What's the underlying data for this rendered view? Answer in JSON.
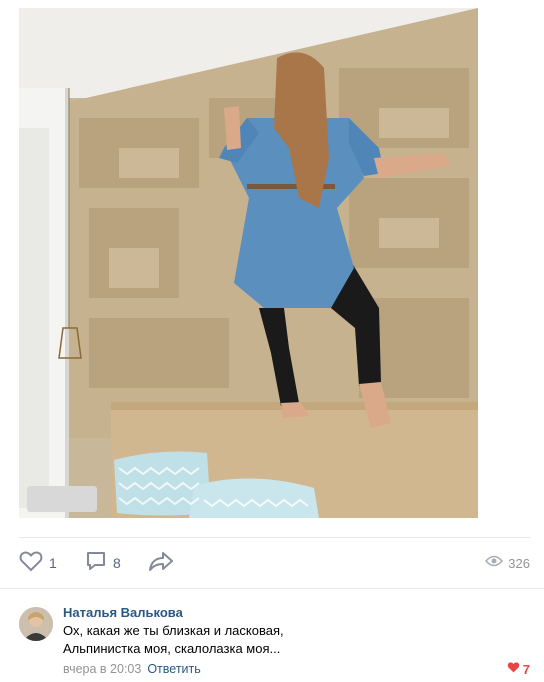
{
  "post": {
    "likes": "1",
    "comments": "8",
    "views": "326"
  },
  "comment": {
    "author": "Наталья Валькова",
    "text_line1": "Ох, какая же ты близкая и ласковая,",
    "text_line2": "Альпинистка моя, скалолазка моя...",
    "time": "вчера в 20:03",
    "reply": "Ответить",
    "likes": "7"
  },
  "colors": {
    "link": "#2a5885",
    "icon": "#828a99",
    "like_red": "#e64646"
  },
  "icons": {
    "like": "heart-outline-icon",
    "comment": "comment-bubble-icon",
    "share": "share-arrow-icon",
    "views": "eye-icon",
    "comment_like": "heart-filled-icon"
  }
}
